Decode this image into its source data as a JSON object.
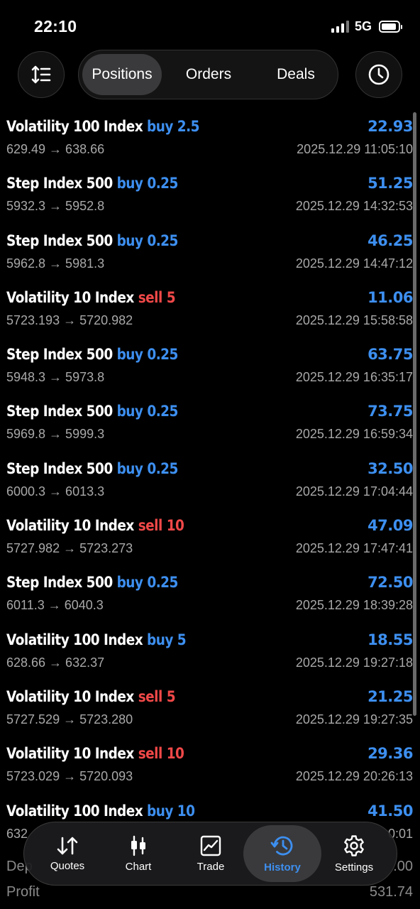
{
  "status": {
    "time": "22:10",
    "network": "5G"
  },
  "tabs": {
    "positions": "Positions",
    "orders": "Orders",
    "deals": "Deals",
    "active": "Positions"
  },
  "deals": [
    {
      "symbol": "Volatility 100 Index",
      "side": "buy",
      "volume": "2.5",
      "prices": "629.49 → 638.66",
      "profit": "22.93",
      "time": "2025.12.29 11:05:10"
    },
    {
      "symbol": "Step Index 500",
      "side": "buy",
      "volume": "0.25",
      "prices": "5932.3 → 5952.8",
      "profit": "51.25",
      "time": "2025.12.29 14:32:53"
    },
    {
      "symbol": "Step Index 500",
      "side": "buy",
      "volume": "0.25",
      "prices": "5962.8 → 5981.3",
      "profit": "46.25",
      "time": "2025.12.29 14:47:12"
    },
    {
      "symbol": "Volatility 10 Index",
      "side": "sell",
      "volume": "5",
      "prices": "5723.193 → 5720.982",
      "profit": "11.06",
      "time": "2025.12.29 15:58:58"
    },
    {
      "symbol": "Step Index 500",
      "side": "buy",
      "volume": "0.25",
      "prices": "5948.3 → 5973.8",
      "profit": "63.75",
      "time": "2025.12.29 16:35:17"
    },
    {
      "symbol": "Step Index 500",
      "side": "buy",
      "volume": "0.25",
      "prices": "5969.8 → 5999.3",
      "profit": "73.75",
      "time": "2025.12.29 16:59:34"
    },
    {
      "symbol": "Step Index 500",
      "side": "buy",
      "volume": "0.25",
      "prices": "6000.3 → 6013.3",
      "profit": "32.50",
      "time": "2025.12.29 17:04:44"
    },
    {
      "symbol": "Volatility 10 Index",
      "side": "sell",
      "volume": "10",
      "prices": "5727.982 → 5723.273",
      "profit": "47.09",
      "time": "2025.12.29 17:47:41"
    },
    {
      "symbol": "Step Index 500",
      "side": "buy",
      "volume": "0.25",
      "prices": "6011.3 → 6040.3",
      "profit": "72.50",
      "time": "2025.12.29 18:39:28"
    },
    {
      "symbol": "Volatility 100 Index",
      "side": "buy",
      "volume": "5",
      "prices": "628.66 → 632.37",
      "profit": "18.55",
      "time": "2025.12.29 19:27:18"
    },
    {
      "symbol": "Volatility 10 Index",
      "side": "sell",
      "volume": "5",
      "prices": "5727.529 → 5723.280",
      "profit": "21.25",
      "time": "2025.12.29 19:27:35"
    },
    {
      "symbol": "Volatility 10 Index",
      "side": "sell",
      "volume": "10",
      "prices": "5723.029 → 5720.093",
      "profit": "29.36",
      "time": "2025.12.29 20:26:13"
    },
    {
      "symbol": "Volatility 100 Index",
      "side": "buy",
      "volume": "10",
      "prices": "632",
      "profit": "41.50",
      "time": "0:01"
    }
  ],
  "summary": {
    "deposit_label": "Dep",
    "deposit_value": ".00",
    "profit_label": "Profit",
    "profit_value": "531.74"
  },
  "nav": {
    "quotes": "Quotes",
    "chart": "Chart",
    "trade": "Trade",
    "history": "History",
    "settings": "Settings",
    "active": "History"
  },
  "colors": {
    "buy": "#3d8ff0",
    "sell": "#f04848",
    "accent": "#3d8ff0",
    "background": "#000000"
  }
}
